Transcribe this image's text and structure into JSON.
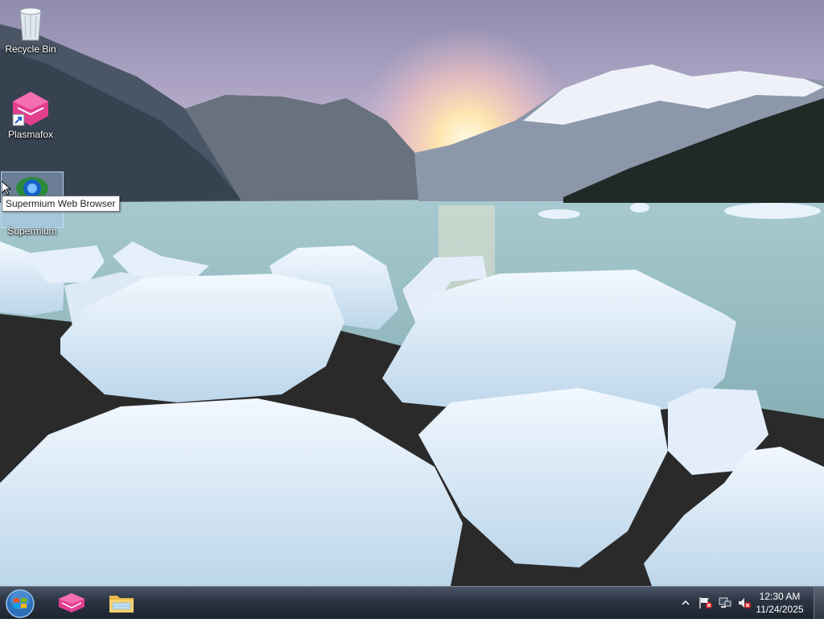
{
  "desktop": {
    "icons": [
      {
        "label": "Recycle Bin",
        "icon": "recycle-bin-icon"
      },
      {
        "label": "Plasmafox",
        "icon": "plasmafox-icon"
      },
      {
        "label": "Supermium",
        "icon": "supermium-icon"
      }
    ],
    "tooltip": "Supermium Web Browser"
  },
  "taskbar": {
    "start_icon": "windows-start-orb-icon",
    "pinned": [
      {
        "name": "Plasmafox",
        "icon": "plasmafox-icon"
      },
      {
        "name": "Windows Explorer",
        "icon": "folder-icon"
      }
    ],
    "tray": {
      "icons": [
        "show-hidden-icons-chevron-icon",
        "action-center-flag-icon",
        "network-icon",
        "volume-muted-icon"
      ]
    },
    "clock": {
      "time": "12:30 AM",
      "date": "11/24/2025"
    }
  },
  "colors": {
    "taskbar": "#2b3342",
    "tooltip_bg": "#ffffff",
    "accent": "#e0408a"
  }
}
